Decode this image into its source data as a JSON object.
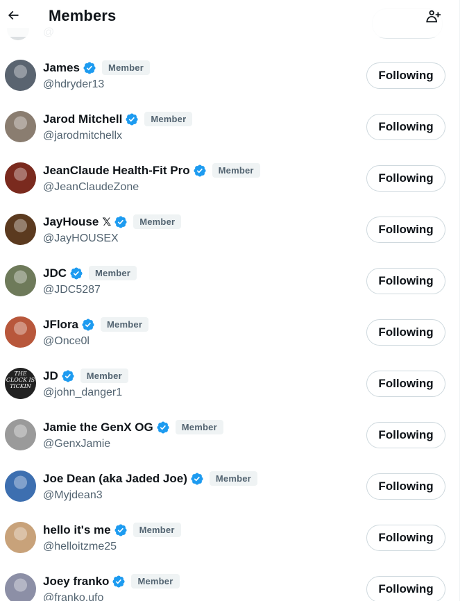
{
  "header": {
    "title": "Members",
    "back_icon": "arrow-left-icon",
    "add_icon": "add-person-icon"
  },
  "colors": {
    "verified": "#1d9bf0",
    "member_tag_bg": "#eff3f4",
    "muted_text": "#536471"
  },
  "ghost_row": {
    "handle": "@"
  },
  "members": [
    {
      "name": "James",
      "handle": "@hdryder13",
      "badge": "Member",
      "button": "Following",
      "avatar_bg": "#5a6470"
    },
    {
      "name": "Jarod Mitchell",
      "handle": "@jarodmitchellx",
      "badge": "Member",
      "button": "Following",
      "avatar_bg": "#8a7d70"
    },
    {
      "name": "JeanClaude Health-Fit Pro",
      "handle": "@JeanClaudeZone",
      "badge": "Member",
      "button": "Following",
      "avatar_bg": "#7a2a1e"
    },
    {
      "name": "JayHouse",
      "name_suffix": "𝕏",
      "handle": "@JayHOUSEX",
      "badge": "Member",
      "button": "Following",
      "avatar_bg": "#5b3a1f"
    },
    {
      "name": "JDC",
      "handle": "@JDC5287",
      "badge": "Member",
      "button": "Following",
      "avatar_bg": "#6e7a5a"
    },
    {
      "name": "JFlora",
      "handle": "@Once0l",
      "badge": "Member",
      "button": "Following",
      "avatar_bg": "#b8573b"
    },
    {
      "name": "JD",
      "handle": "@john_danger1",
      "badge": "Member",
      "button": "Following",
      "avatar_bg": "#222222",
      "avatar_text": "THE CLOCK IS TICKIN"
    },
    {
      "name": "Jamie the GenX OG",
      "handle": "@GenxJamie",
      "badge": "Member",
      "button": "Following",
      "avatar_bg": "#9a9a9a"
    },
    {
      "name": "Joe Dean (aka Jaded Joe)",
      "handle": "@Myjdean3",
      "badge": "Member",
      "button": "Following",
      "avatar_bg": "#3d6fb0"
    },
    {
      "name": "hello it's me",
      "handle": "@helloitzme25",
      "badge": "Member",
      "button": "Following",
      "avatar_bg": "#c8a27a"
    },
    {
      "name": "Joey franko",
      "handle": "@franko.ufo",
      "badge": "Member",
      "button": "Following",
      "avatar_bg": "#8c8fa6"
    }
  ]
}
